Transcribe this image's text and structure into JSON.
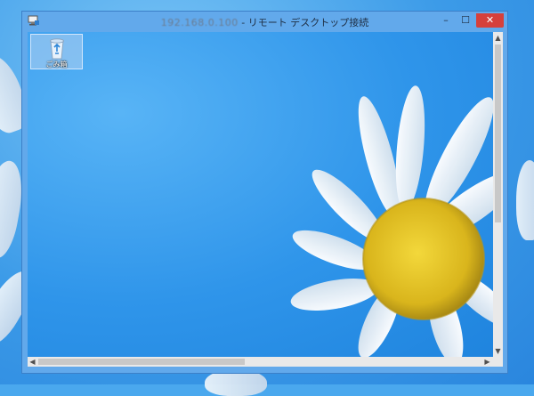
{
  "window": {
    "title_host": "192.168.0.100",
    "title_suffix": " - リモート デスクトップ接続",
    "minimize_glyph": "–",
    "maximize_glyph": "☐",
    "close_glyph": "✕"
  },
  "desktop": {
    "icons": [
      {
        "label": "ごみ箱",
        "icon": "recycle-bin-icon"
      }
    ]
  },
  "scrollbars": {
    "up_arrow": "▲",
    "down_arrow": "▼",
    "left_arrow": "◀",
    "right_arrow": "▶"
  },
  "colors": {
    "close_button": "#d6403b",
    "window_frame": "#62a9eb",
    "desktop_blue": "#2f95ea"
  }
}
